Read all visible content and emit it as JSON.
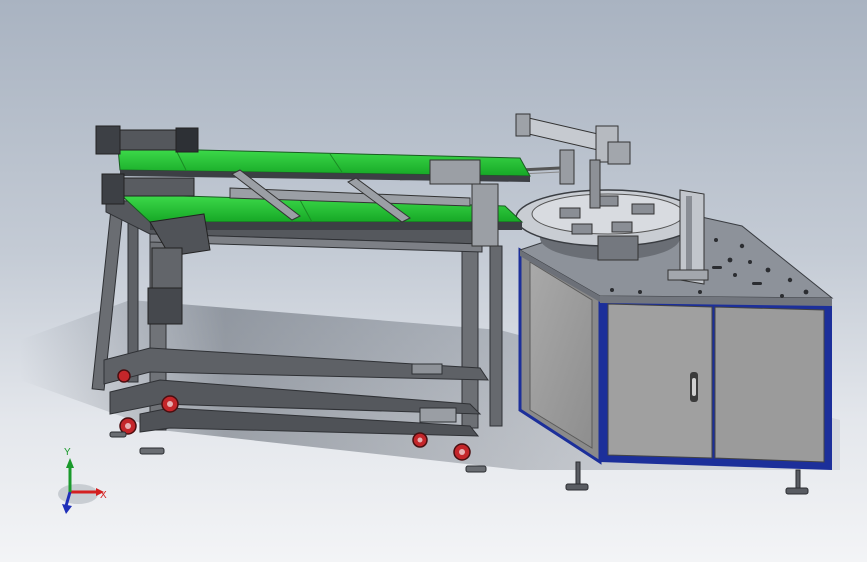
{
  "viewport": {
    "background_top": "#a9b3c1",
    "background_bottom": "#f3f4f6"
  },
  "colors": {
    "belt_green": "#22c434",
    "cabinet_frame_blue": "#1c2f9a",
    "cabinet_panel_gray": "#9c9c9c",
    "table_top_gray": "#8d929a",
    "aluminum_frame": "#5e6166",
    "caster_red": "#c4262a"
  },
  "components": {
    "left_conveyor": "belt-conveyor",
    "right_machine": "turntable-cabinet"
  },
  "triad": {
    "x_label": "X",
    "y_label": "Y",
    "x_color": "#d42020",
    "y_color": "#1a9a2c",
    "z_color": "#1f2fb8"
  }
}
